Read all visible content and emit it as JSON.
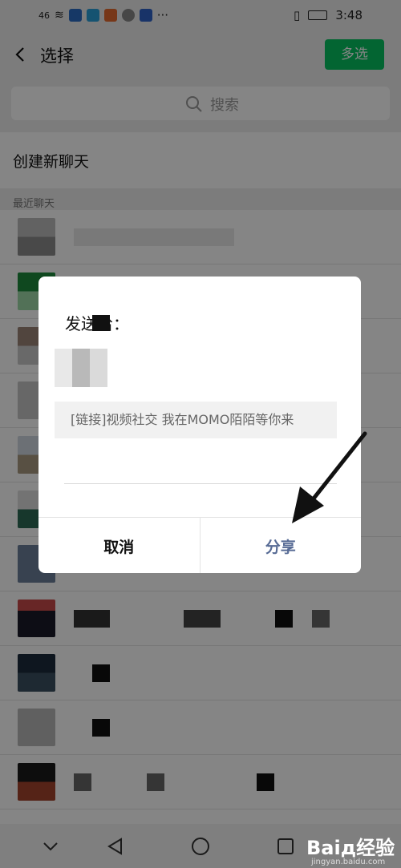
{
  "status_bar": {
    "left_signal": "46",
    "dots": "···",
    "time": "3:48"
  },
  "topbar": {
    "title": "选择",
    "multi_select_label": "多选"
  },
  "search": {
    "placeholder": "搜索"
  },
  "new_chat": {
    "label": "创建新聊天"
  },
  "section": {
    "label": "最近聊天"
  },
  "dialog": {
    "send_to_label": "发送给：",
    "preview_text": "[链接]视频社交 我在MOMO陌陌等你来",
    "cancel_label": "取消",
    "share_label": "分享"
  },
  "colors": {
    "accent_green": "#07c160",
    "share_blue": "#576b95"
  },
  "watermark": {
    "brand": "Baiд经验",
    "url": "jingyan.baidu.com"
  }
}
